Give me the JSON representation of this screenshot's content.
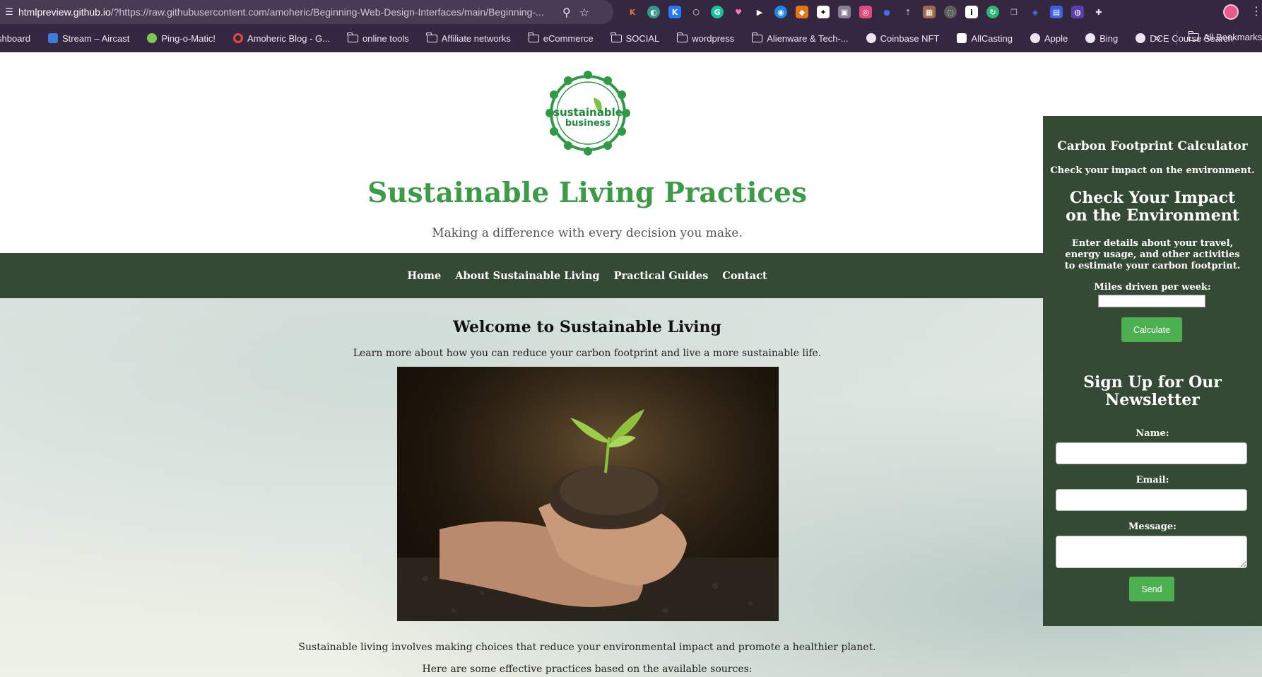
{
  "browser": {
    "url_host": "htmlpreview.github.io",
    "url_rest": "/?https://raw.githubusercontent.com/amoheric/Beginning-Web-Design-Interfaces/main/Beginning-...",
    "bookmarks": [
      {
        "label": "shboard",
        "icon": "dashboard-icon"
      },
      {
        "label": "Stream – Aircast",
        "icon": "aircast-icon"
      },
      {
        "label": "Ping-o-Matic!",
        "icon": "ping-icon"
      },
      {
        "label": "Amoheric Blog - G...",
        "icon": "google-icon"
      },
      {
        "label": "online tools",
        "icon": "folder-icon"
      },
      {
        "label": "Affiliate networks",
        "icon": "folder-icon"
      },
      {
        "label": "eCommerce",
        "icon": "folder-icon"
      },
      {
        "label": "SOCIAL",
        "icon": "folder-icon"
      },
      {
        "label": "wordpress",
        "icon": "folder-icon"
      },
      {
        "label": "Alienware & Tech-...",
        "icon": "folder-icon"
      },
      {
        "label": "Coinbase NFT",
        "icon": "globe-icon"
      },
      {
        "label": "AllCasting",
        "icon": "allcasting-icon"
      },
      {
        "label": "Apple",
        "icon": "globe-icon"
      },
      {
        "label": "Bing",
        "icon": "globe-icon"
      },
      {
        "label": "DCE Course Search",
        "icon": "globe-icon"
      }
    ],
    "more_label": "»",
    "all_bookmarks": "All Bookmarks"
  },
  "site": {
    "title": "Sustainable Living Practices",
    "tagline": "Making a difference with every decision you make.",
    "logo_text": "sustainable business"
  },
  "nav": {
    "items": [
      "Home",
      "About Sustainable Living",
      "Practical Guides",
      "Contact"
    ]
  },
  "main": {
    "heading": "Welcome to Sustainable Living",
    "intro": "Learn more about how you can reduce your carbon footprint and live a more sustainable life.",
    "paragraph1": "Sustainable living involves making choices that reduce your environmental impact and promote a healthier planet.",
    "paragraph2": "Here are some effective practices based on the available sources:"
  },
  "sidebar": {
    "calc_title": "Carbon Footprint Calculator",
    "calc_subtitle": "Check your impact on the environment.",
    "calc_heading": "Check Your Impact on the Environment",
    "calc_desc": "Enter details about your travel, energy usage, and other activities to estimate your carbon footprint.",
    "miles_label": "Miles driven per week:",
    "miles_value": "",
    "calc_button": "Calculate",
    "newsletter_heading": "Sign Up for Our Newsletter",
    "name_label": "Name:",
    "email_label": "Email:",
    "message_label": "Message:",
    "send_button": "Send"
  },
  "colors": {
    "accent_green": "#3d9a47",
    "nav_bg": "#344a34",
    "button_green": "#4caf50",
    "chrome_bg": "#35273f"
  }
}
